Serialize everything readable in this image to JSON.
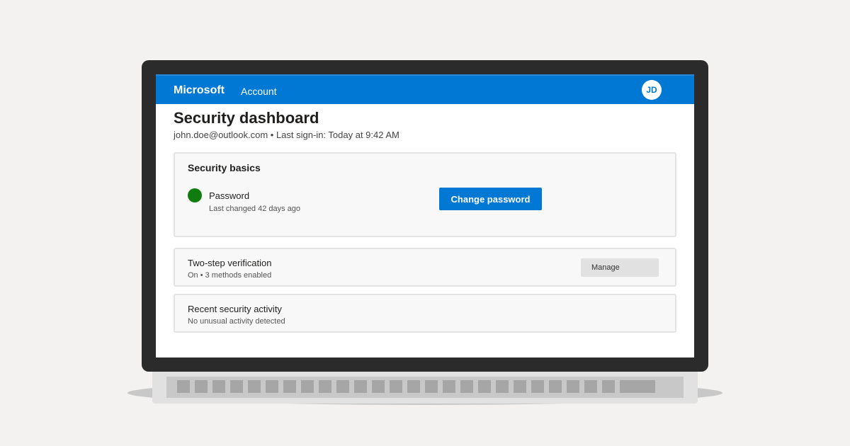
{
  "header": {
    "brand": "Microsoft",
    "nav_account": "Account",
    "avatar_initials": "JD"
  },
  "page": {
    "title": "Security dashboard",
    "subtitle": "john.doe@outlook.com • Last sign-in: Today at 9:42 AM"
  },
  "security_basics": {
    "title": "Security basics",
    "password_label": "Password",
    "password_status": "Last changed 42 days ago",
    "status_color": "#107c10",
    "change_button": "Change password"
  },
  "two_step": {
    "label": "Two-step verification",
    "status": "On • 3 methods enabled",
    "manage_button": "Manage"
  },
  "activity": {
    "label": "Recent security activity",
    "status": "No unusual activity detected"
  },
  "colors": {
    "accent": "#0078d4",
    "bezel": "#2b2b2b",
    "background": "#f3f2f1"
  }
}
